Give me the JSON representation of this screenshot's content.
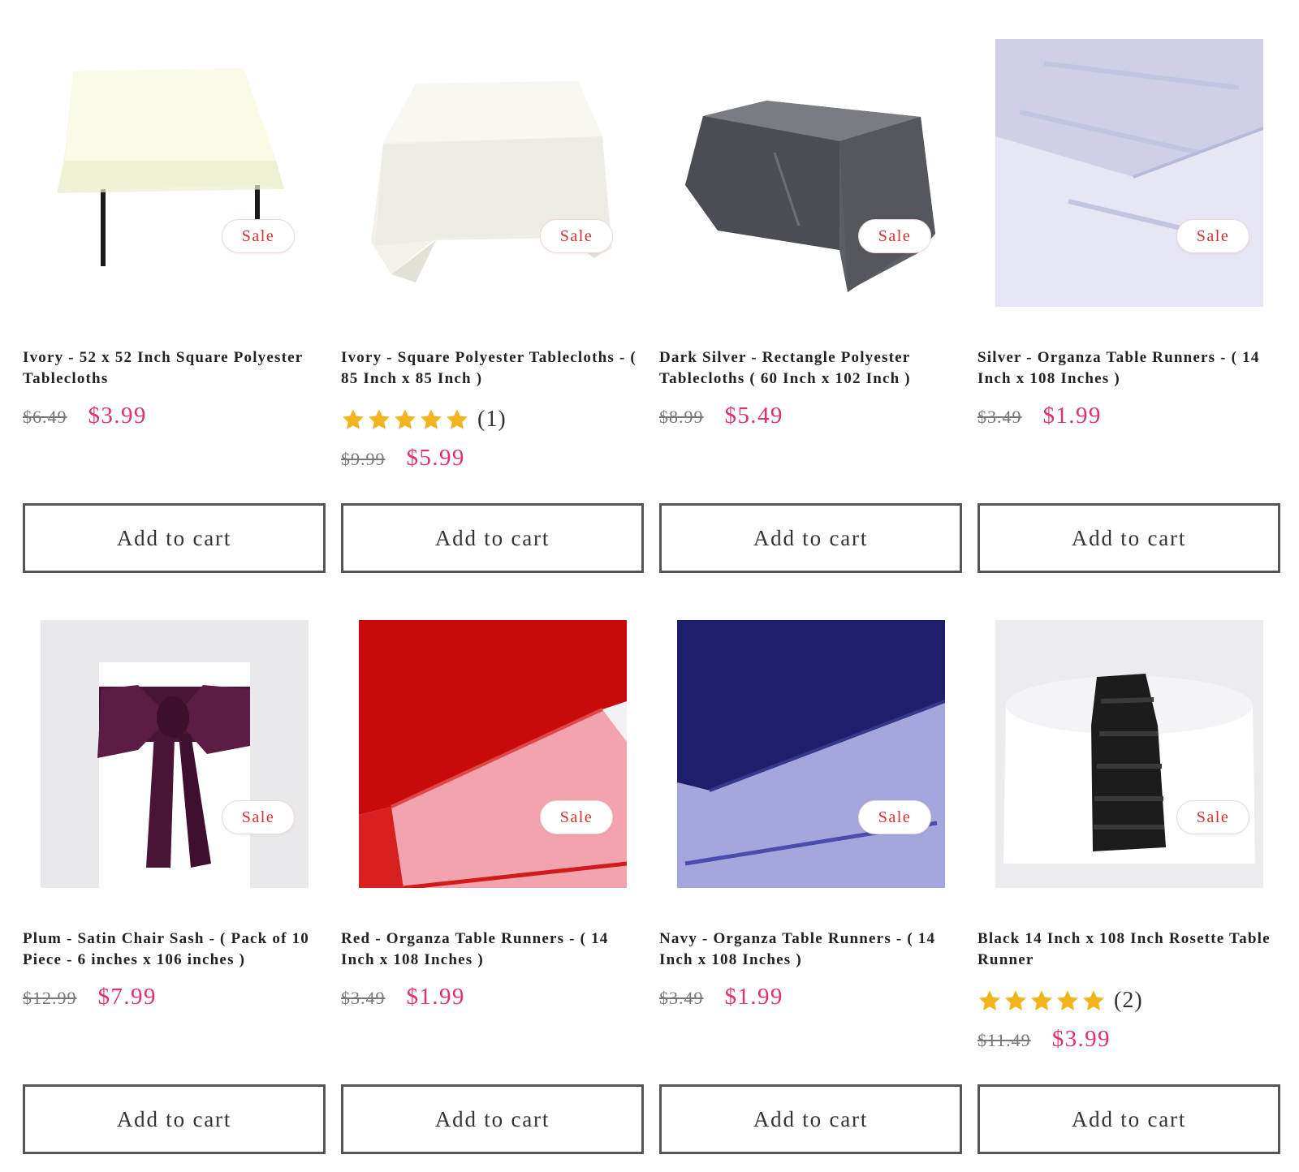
{
  "products": [
    {
      "title": "Ivory - 52 x 52 Inch Square Polyester Tablecloths",
      "image_icon": "ivory-square-tablecloth-image",
      "badge": "Sale",
      "old_price": "$6.49",
      "price": "$3.99",
      "button": "Add to cart"
    },
    {
      "title": "Ivory - Square Polyester Tablecloths - ( 85 Inch x 85 Inch )",
      "image_icon": "ivory-large-tablecloth-image",
      "badge": "Sale",
      "rating": 5,
      "review_count": "(1)",
      "old_price": "$9.99",
      "price": "$5.99",
      "button": "Add to cart"
    },
    {
      "title": "Dark Silver - Rectangle Polyester Tablecloths ( 60 Inch x 102 Inch )",
      "image_icon": "dark-silver-tablecloth-image",
      "badge": "Sale",
      "old_price": "$8.99",
      "price": "$5.49",
      "button": "Add to cart"
    },
    {
      "title": "Silver - Organza Table Runners - ( 14 Inch x 108 Inches )",
      "image_icon": "silver-organza-runner-image",
      "badge": "Sale",
      "old_price": "$3.49",
      "price": "$1.99",
      "button": "Add to cart"
    },
    {
      "title": "Plum - Satin Chair Sash - ( Pack of 10 Piece - 6 inches x 106 inches )",
      "image_icon": "plum-chair-sash-image",
      "badge": "Sale",
      "old_price": "$12.99",
      "price": "$7.99",
      "button": "Add to cart"
    },
    {
      "title": "Red - Organza Table Runners - ( 14 Inch x 108 Inches )",
      "image_icon": "red-organza-runner-image",
      "badge": "Sale",
      "old_price": "$3.49",
      "price": "$1.99",
      "button": "Add to cart"
    },
    {
      "title": "Navy - Organza Table Runners - ( 14 Inch x 108 Inches )",
      "image_icon": "navy-organza-runner-image",
      "badge": "Sale",
      "old_price": "$3.49",
      "price": "$1.99",
      "button": "Add to cart"
    },
    {
      "title": "Black 14 Inch x 108 Inch Rosette Table Runner",
      "image_icon": "black-rosette-runner-image",
      "badge": "Sale",
      "rating": 5,
      "review_count": "(2)",
      "old_price": "$11.49",
      "price": "$3.99",
      "button": "Add to cart"
    }
  ],
  "colors": {
    "sale_text": "#d32f2f",
    "price": "#e0316b",
    "old_price": "#777777",
    "star": "#f2b51d",
    "button_border": "#555555"
  }
}
